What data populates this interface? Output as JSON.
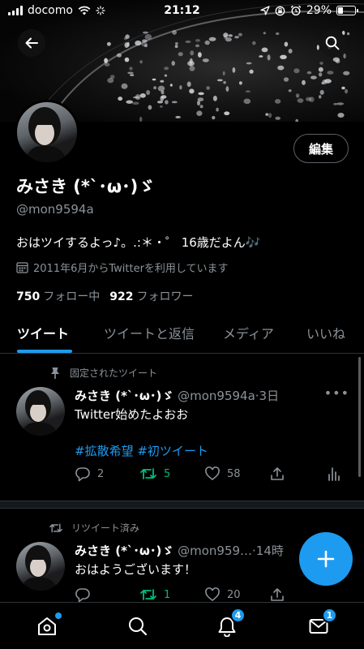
{
  "status_bar": {
    "carrier": "docomo",
    "time": "21:12",
    "battery_text": "29%",
    "battery_level": 0.29
  },
  "header": {
    "back_icon": "back-arrow-icon",
    "search_icon": "search-icon"
  },
  "profile": {
    "name": "みさき (*`･ω･)ゞ",
    "handle": "@mon9594a",
    "bio": "おはツイするよっ♪。.:＊・゜ 16歳だよん🎶",
    "joined": "2011年6月からTwitterを利用しています",
    "edit_label": "編集",
    "following_count": "750",
    "following_label": "フォロー中",
    "followers_count": "922",
    "followers_label": "フォロワー"
  },
  "tabs": [
    {
      "label": "ツイート",
      "active": true
    },
    {
      "label": "ツイートと返信",
      "active": false
    },
    {
      "label": "メディア",
      "active": false
    },
    {
      "label": "いいね",
      "active": false
    }
  ],
  "tweets": [
    {
      "context": "固定されたツイート",
      "name": "みさき (*`･ω･)ゞ",
      "meta": "@mon9594a·3日",
      "text": "Twitter始めたよおお",
      "tags": "#拡散希望 #初ツイート",
      "reply_count": "2",
      "retweet_count": "5",
      "like_count": "58"
    },
    {
      "context": "リツイート済み",
      "name": "みさき (*`･ω･)ゞ",
      "meta": "@mon959…·14時",
      "text": "おはようございます！",
      "reply_count": "",
      "retweet_count": "1",
      "like_count": "20"
    }
  ],
  "bottom_nav": {
    "notifications_badge": "4",
    "messages_badge": "1"
  },
  "colors": {
    "accent": "#1d9bf0",
    "retweet": "#00ba7c",
    "muted": "#8b9298"
  }
}
